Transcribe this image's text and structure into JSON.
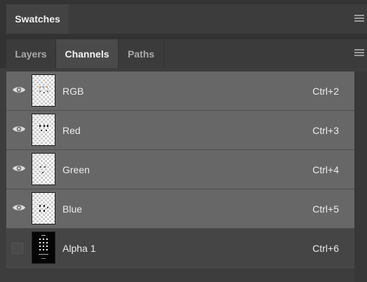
{
  "panels": {
    "top_tab": "Swatches",
    "tabs": [
      {
        "label": "Layers",
        "active": false
      },
      {
        "label": "Channels",
        "active": true
      },
      {
        "label": "Paths",
        "active": false
      }
    ]
  },
  "channels": [
    {
      "name": "RGB",
      "shortcut": "Ctrl+2",
      "visible": true,
      "selected": true,
      "thumb": "rgb"
    },
    {
      "name": "Red",
      "shortcut": "Ctrl+3",
      "visible": true,
      "selected": true,
      "thumb": "red"
    },
    {
      "name": "Green",
      "shortcut": "Ctrl+4",
      "visible": true,
      "selected": true,
      "thumb": "green"
    },
    {
      "name": "Blue",
      "shortcut": "Ctrl+5",
      "visible": true,
      "selected": true,
      "thumb": "blue"
    },
    {
      "name": "Alpha 1",
      "shortcut": "Ctrl+6",
      "visible": false,
      "selected": false,
      "thumb": "alpha"
    }
  ],
  "icons": {
    "visibility": "eye-icon",
    "panel_menu": "hamburger-menu-icon"
  },
  "colors": {
    "selected_row": "#676767",
    "unselected_row": "#454545",
    "panel_bg": "#323232"
  }
}
